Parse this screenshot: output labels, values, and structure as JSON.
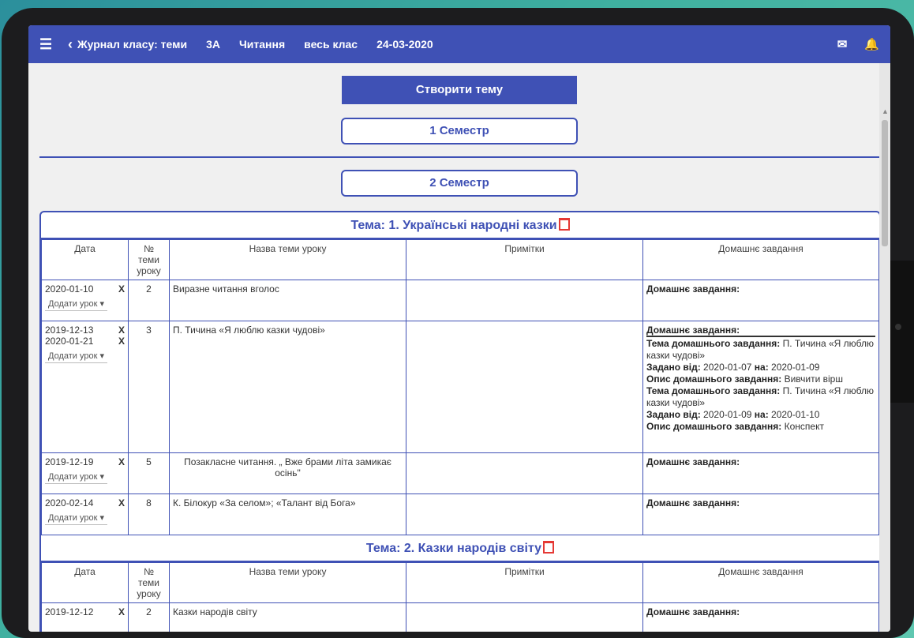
{
  "topbar": {
    "title": "Журнал класу: теми",
    "class": "3А",
    "subject": "Читання",
    "group": "весь клас",
    "date": "24-03-2020",
    "menu_icon": "☰",
    "back_icon": "‹",
    "mail_icon": "✉",
    "bell_icon": "🔔"
  },
  "buttons": {
    "create_topic": "Створити тему",
    "semester1": "1 Семестр",
    "semester2": "2 Семестр"
  },
  "columns": {
    "date": "Дата",
    "num": "№ теми уроку",
    "lesson": "Назва теми уроку",
    "notes": "Примітки",
    "homework": "Домашнє завдання"
  },
  "add_lesson": "Додати урок",
  "remove_x": "X",
  "topic1": {
    "title": "Тема: 1. Українські народні казки",
    "rows": [
      {
        "dates": [
          "2020-01-10"
        ],
        "num": "2",
        "lesson": "Виразне читання вголос",
        "notes": "",
        "hw_head": "Домашнє завдання:"
      },
      {
        "dates": [
          "2019-12-13",
          "2020-01-21"
        ],
        "num": "3",
        "lesson": "П. Тичина «Я люблю казки чудові»",
        "notes": "",
        "hw_head": "Домашнє завдання:",
        "hw_items": [
          {
            "k1": "Тема домашнього завдання:",
            "v1": " П. Тичина «Я люблю казки чудові»",
            "k2": "Задано від:",
            "v2": " 2020-01-07 ",
            "k3": "на:",
            "v3": " 2020-01-09",
            "k4": "Опис домашнього завдання:",
            "v4": " Вивчити вірш"
          },
          {
            "k1": "Тема домашнього завдання:",
            "v1": " П. Тичина «Я люблю казки чудові»",
            "k2": "Задано від:",
            "v2": " 2020-01-09 ",
            "k3": "на:",
            "v3": " 2020-01-10",
            "k4": "Опис домашнього завдання:",
            "v4": " Конспект"
          }
        ]
      },
      {
        "dates": [
          "2019-12-19"
        ],
        "num": "5",
        "lesson": "Позакласне читання. „ Вже брами літа замикає осінь\"",
        "notes": "",
        "hw_head": "Домашнє завдання:"
      },
      {
        "dates": [
          "2020-02-14"
        ],
        "num": "8",
        "lesson": "К. Білокур «За селом»; «Талант від Бога»",
        "notes": "",
        "hw_head": "Домашнє завдання:"
      }
    ]
  },
  "topic2": {
    "title": "Тема: 2. Казки народів світу",
    "rows": [
      {
        "date": "2019-12-12",
        "num": "2",
        "lesson": "Казки народів світу",
        "hw_head": "Домашнє завдання:"
      }
    ]
  },
  "colors": {
    "primary": "#3f51b5",
    "danger": "#e53935"
  }
}
